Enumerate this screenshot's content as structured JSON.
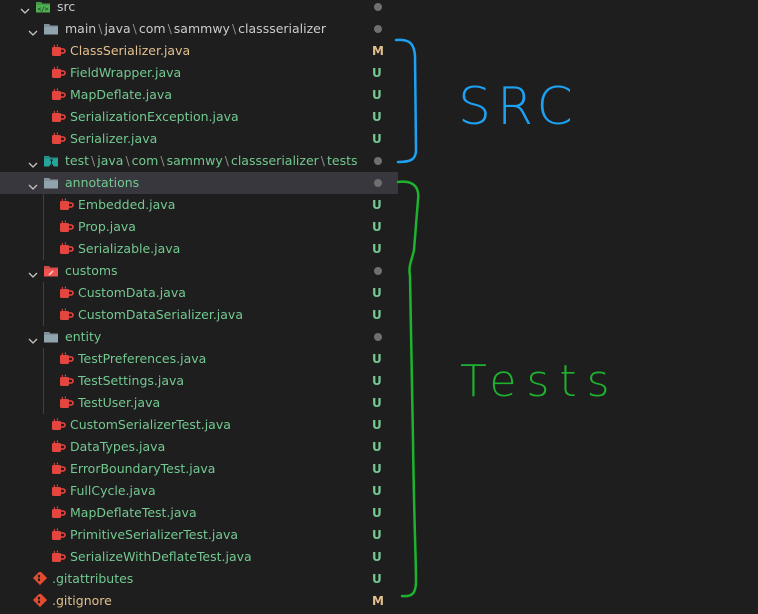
{
  "colors": {
    "modified": "#e2c08d",
    "untracked": "#73c991",
    "java_icon": "#e5453f",
    "src_annotation": "#1da1f2",
    "tests_annotation": "#1db32e"
  },
  "tree": [
    {
      "label": "src",
      "kind": "folder",
      "state": "def",
      "icon": "folder-src-icon",
      "decoration": "dot",
      "chevron": "down"
    },
    {
      "label": [
        "main",
        "java",
        "com",
        "sammwy",
        "classserializer"
      ],
      "kind": "folder",
      "state": "def",
      "icon": "folder-open-icon",
      "decoration": "dot",
      "chevron": "down"
    },
    {
      "label": "ClassSerializer.java",
      "kind": "file",
      "state": "mod",
      "icon": "java-icon",
      "decoration": "M"
    },
    {
      "label": "FieldWrapper.java",
      "kind": "file",
      "state": "unt",
      "icon": "java-icon",
      "decoration": "U"
    },
    {
      "label": "MapDeflate.java",
      "kind": "file",
      "state": "unt",
      "icon": "java-icon",
      "decoration": "U"
    },
    {
      "label": "SerializationException.java",
      "kind": "file",
      "state": "unt",
      "icon": "java-icon",
      "decoration": "U"
    },
    {
      "label": "Serializer.java",
      "kind": "file",
      "state": "unt",
      "icon": "java-icon",
      "decoration": "U"
    },
    {
      "label": [
        "test",
        "java",
        "com",
        "sammwy",
        "classserializer",
        "tests"
      ],
      "kind": "folder",
      "state": "unt",
      "icon": "folder-test-icon",
      "decoration": "dot",
      "chevron": "down"
    },
    {
      "label": "annotations",
      "kind": "folder",
      "state": "unt",
      "icon": "folder-open-icon",
      "decoration": "dot",
      "chevron": "down",
      "selected": true
    },
    {
      "label": "Embedded.java",
      "kind": "file",
      "state": "unt",
      "icon": "java-icon",
      "decoration": "U"
    },
    {
      "label": "Prop.java",
      "kind": "file",
      "state": "unt",
      "icon": "java-icon",
      "decoration": "U"
    },
    {
      "label": "Serializable.java",
      "kind": "file",
      "state": "unt",
      "icon": "java-icon",
      "decoration": "U"
    },
    {
      "label": "customs",
      "kind": "folder",
      "state": "unt",
      "icon": "folder-custom-icon",
      "decoration": "dot",
      "chevron": "down"
    },
    {
      "label": "CustomData.java",
      "kind": "file",
      "state": "unt",
      "icon": "java-icon",
      "decoration": "U"
    },
    {
      "label": "CustomDataSerializer.java",
      "kind": "file",
      "state": "unt",
      "icon": "java-icon",
      "decoration": "U"
    },
    {
      "label": "entity",
      "kind": "folder",
      "state": "unt",
      "icon": "folder-open-icon",
      "decoration": "dot",
      "chevron": "down"
    },
    {
      "label": "TestPreferences.java",
      "kind": "file",
      "state": "unt",
      "icon": "java-icon",
      "decoration": "U"
    },
    {
      "label": "TestSettings.java",
      "kind": "file",
      "state": "unt",
      "icon": "java-icon",
      "decoration": "U"
    },
    {
      "label": "TestUser.java",
      "kind": "file",
      "state": "unt",
      "icon": "java-icon",
      "decoration": "U"
    },
    {
      "label": "CustomSerializerTest.java",
      "kind": "file",
      "state": "unt",
      "icon": "java-icon",
      "decoration": "U"
    },
    {
      "label": "DataTypes.java",
      "kind": "file",
      "state": "unt",
      "icon": "java-icon",
      "decoration": "U"
    },
    {
      "label": "ErrorBoundaryTest.java",
      "kind": "file",
      "state": "unt",
      "icon": "java-icon",
      "decoration": "U"
    },
    {
      "label": "FullCycle.java",
      "kind": "file",
      "state": "unt",
      "icon": "java-icon",
      "decoration": "U"
    },
    {
      "label": "MapDeflateTest.java",
      "kind": "file",
      "state": "unt",
      "icon": "java-icon",
      "decoration": "U"
    },
    {
      "label": "PrimitiveSerializerTest.java",
      "kind": "file",
      "state": "unt",
      "icon": "java-icon",
      "decoration": "U"
    },
    {
      "label": "SerializeWithDeflateTest.java",
      "kind": "file",
      "state": "unt",
      "icon": "java-icon",
      "decoration": "U"
    },
    {
      "label": ".gitattributes",
      "kind": "file",
      "state": "unt",
      "icon": "git-icon",
      "decoration": "U"
    },
    {
      "label": ".gitignore",
      "kind": "file",
      "state": "mod",
      "icon": "git-icon",
      "decoration": "M"
    }
  ],
  "annotations": {
    "src": "SRC",
    "tests": "Tests"
  }
}
